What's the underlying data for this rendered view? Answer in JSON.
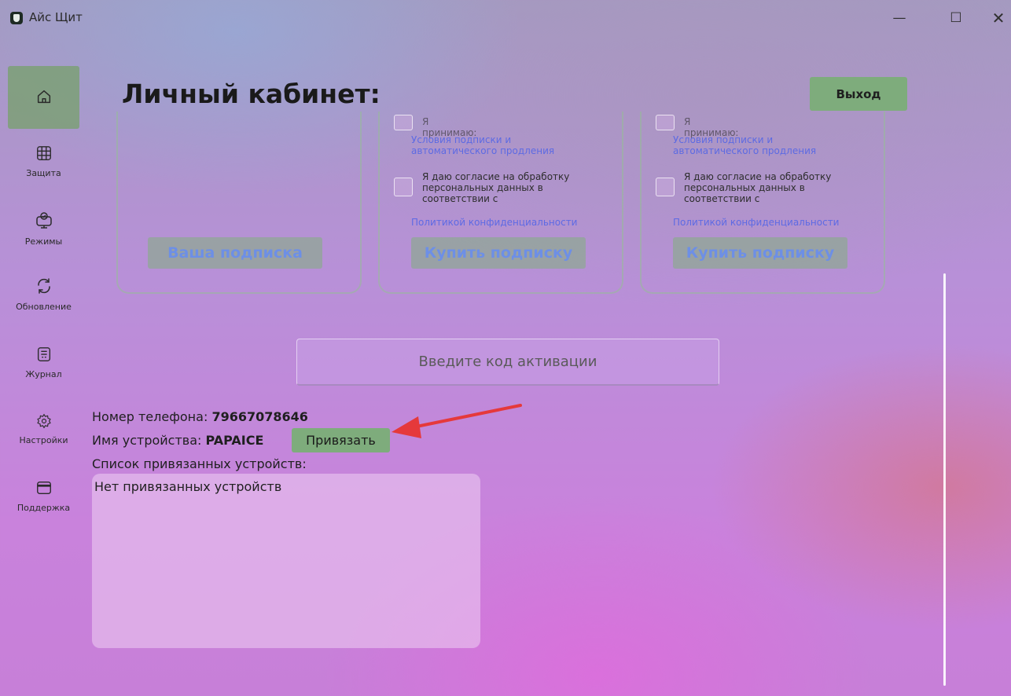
{
  "window": {
    "title": "Айс Щит",
    "minimize": "—",
    "maximize": "☐",
    "close": "✕"
  },
  "sidebar": {
    "items": [
      {
        "label": "",
        "icon": "home-icon"
      },
      {
        "label": "Защита",
        "icon": "grid-icon"
      },
      {
        "label": "Режимы",
        "icon": "monitor-icon"
      },
      {
        "label": "Обновление",
        "icon": "refresh-icon"
      },
      {
        "label": "Журнал",
        "icon": "journal-icon"
      },
      {
        "label": "Настройки",
        "icon": "gear-icon"
      },
      {
        "label": "Поддержка",
        "icon": "window-icon"
      }
    ]
  },
  "header": {
    "title": "Личный кабинет:",
    "logout_label": "Выход"
  },
  "cards": [
    {
      "button_label": "Ваша подписка"
    },
    {
      "accept_text": "Я принимаю:",
      "terms_link": "Условия подписки и автоматического продления",
      "consent_text": "Я даю согласие на обработку персональных данных в соответствии с",
      "privacy_link": "Политикой конфиденциальности",
      "button_label": "Купить подписку"
    },
    {
      "accept_text": "Я принимаю:",
      "terms_link": "Условия подписки и автоматического продления",
      "consent_text": "Я даю согласие на обработку персональных данных в соответствии с",
      "privacy_link": "Политикой конфиденциальности",
      "button_label": "Купить подписку"
    }
  ],
  "activation": {
    "placeholder": "Введите код активации",
    "value": ""
  },
  "account": {
    "phone_label": "Номер телефона:",
    "phone_value": "79667078646",
    "device_label": "Имя устройства:",
    "device_value": "PAPAICE",
    "bind_label": "Привязать",
    "devices_label": "Список привязанных устройств:",
    "devices_empty": "Нет привязанных устройств"
  },
  "colors": {
    "accent_green": "#7eac7c",
    "link_blue": "#4f63e8",
    "arrow_red": "#e5393b"
  }
}
